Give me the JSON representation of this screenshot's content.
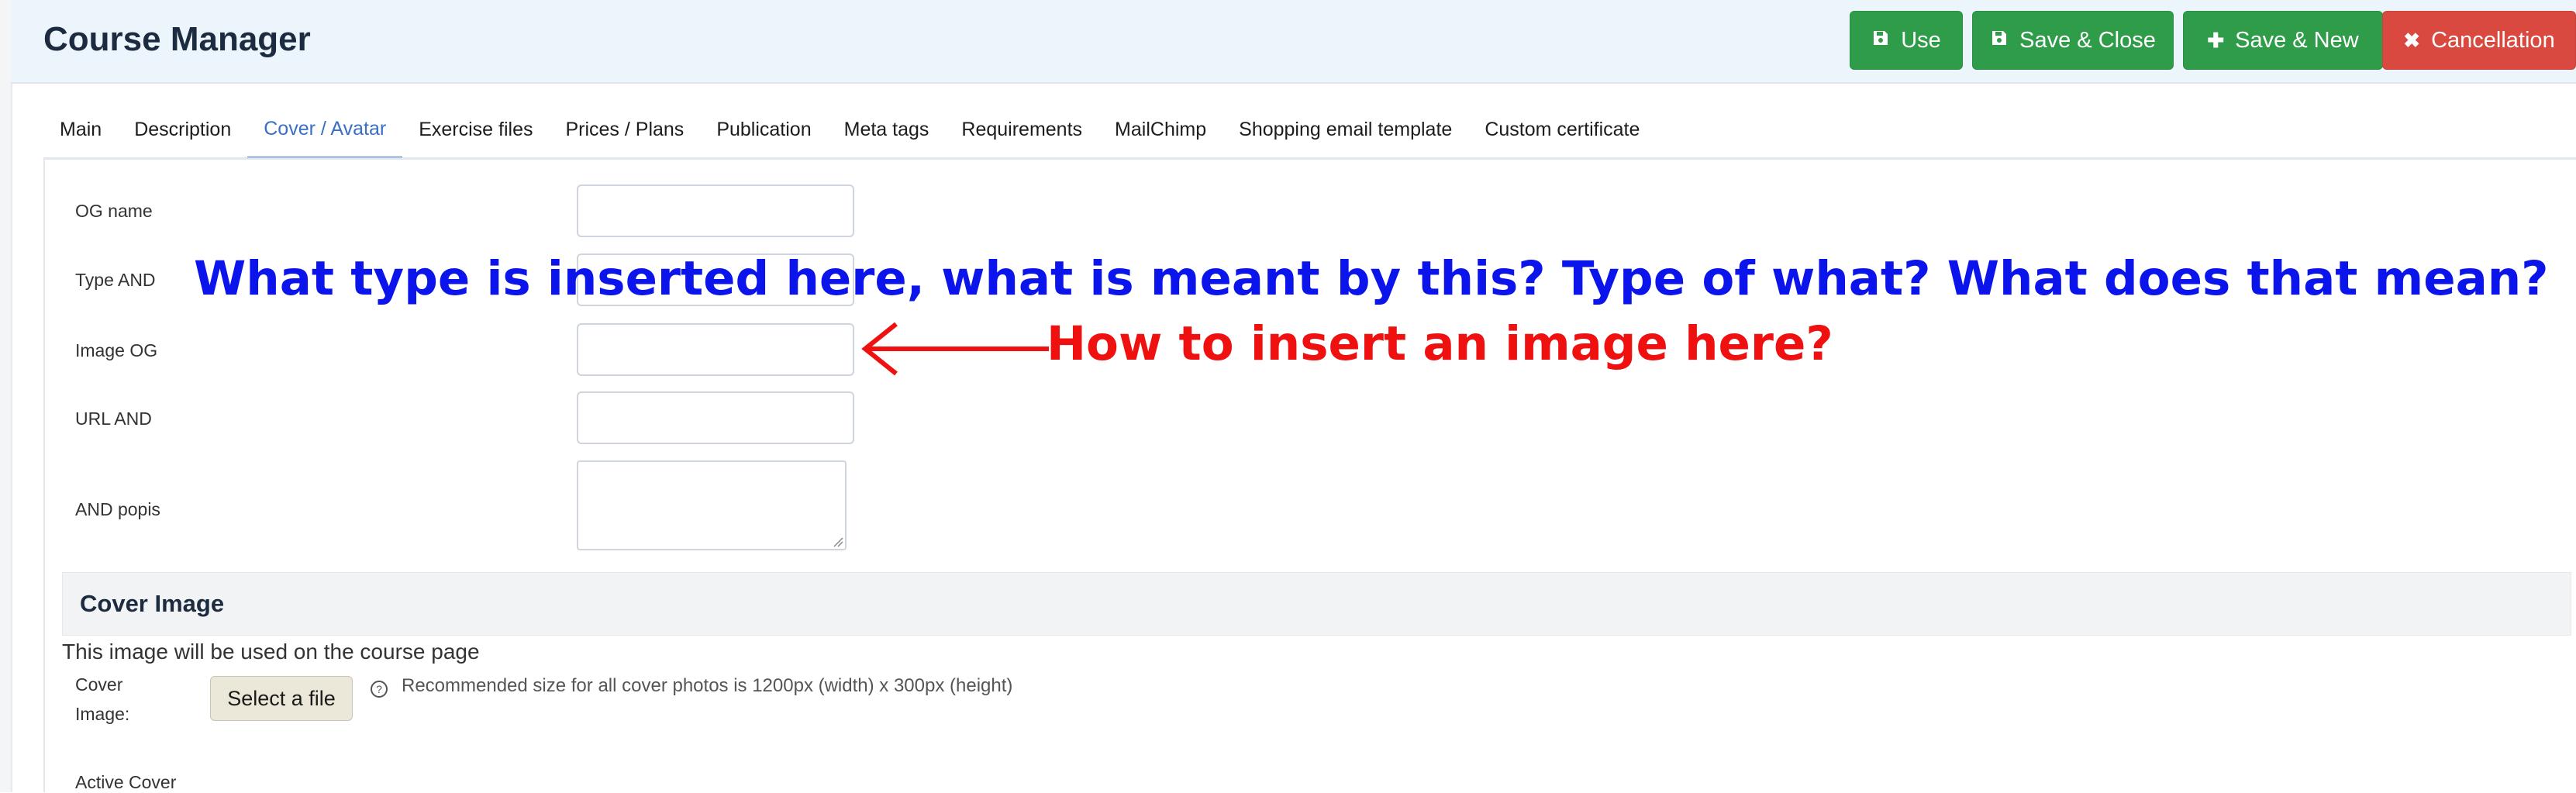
{
  "header": {
    "title": "Course Manager",
    "buttons": [
      {
        "label": "Use",
        "icon": "floppy-disk-icon",
        "color": "#2e9c48"
      },
      {
        "label": "Save & Close",
        "icon": "floppy-disk-icon",
        "color": "#2e9c48"
      },
      {
        "label": "Save & New",
        "icon": "plus-icon",
        "color": "#2e9c48"
      },
      {
        "label": "Cancellation",
        "icon": "close-x-icon",
        "color": "#d9493f"
      }
    ]
  },
  "tabs": [
    {
      "label": "Main",
      "active": false
    },
    {
      "label": "Description",
      "active": false
    },
    {
      "label": "Cover / Avatar",
      "active": true
    },
    {
      "label": "Exercise files",
      "active": false
    },
    {
      "label": "Prices / Plans",
      "active": false
    },
    {
      "label": "Publication",
      "active": false
    },
    {
      "label": "Meta tags",
      "active": false
    },
    {
      "label": "Requirements",
      "active": false
    },
    {
      "label": "MailChimp",
      "active": false
    },
    {
      "label": "Shopping email template",
      "active": false
    },
    {
      "label": "Custom certificate",
      "active": false
    }
  ],
  "form": {
    "og_name": {
      "label": "OG name",
      "value": ""
    },
    "type": {
      "label": "Type AND",
      "value": ""
    },
    "image_og": {
      "label": "Image OG",
      "value": ""
    },
    "url": {
      "label": "URL AND",
      "value": ""
    },
    "description": {
      "label": "AND popis",
      "value": ""
    }
  },
  "cover_section": {
    "title": "Cover Image",
    "description": "This image will be used on the course page",
    "cover_label_line1": "Cover",
    "cover_label_line2": "Image:",
    "select_file_label": "Select a file",
    "help_text": "Recommended size for all cover photos is 1200px (width) x 300px (height)",
    "active_cover_label": "Active Cover"
  },
  "annotations": {
    "blue_note": "What type is inserted here, what is meant by this? Type of what? What does that mean?",
    "red_note": "How to insert an image here?",
    "blue_color": "#0b14ea",
    "red_color": "#ef1010"
  }
}
